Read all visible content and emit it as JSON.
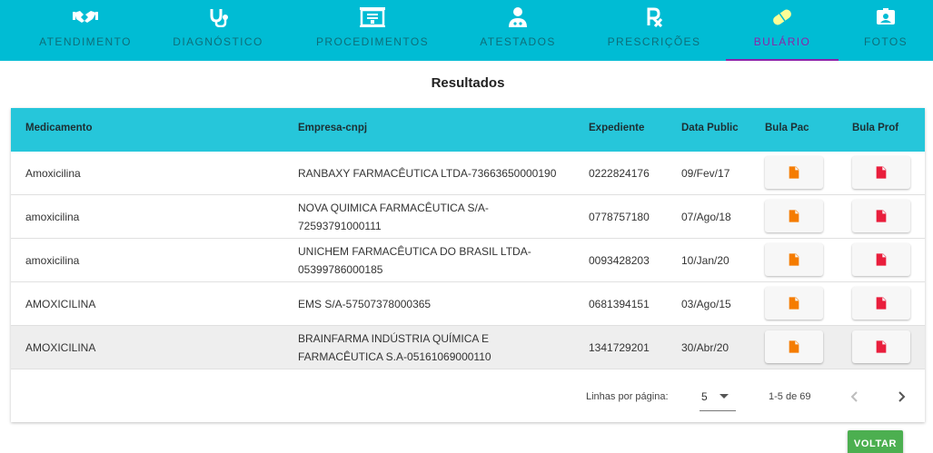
{
  "nav": {
    "tabs": [
      {
        "label": "ATENDIMENTO",
        "icon": "handshake-icon"
      },
      {
        "label": "DIAGNÓSTICO",
        "icon": "stethoscope-icon"
      },
      {
        "label": "PROCEDIMENTOS",
        "icon": "procedure-board-icon"
      },
      {
        "label": "ATESTADOS",
        "icon": "doctor-icon"
      },
      {
        "label": "PRESCRIÇÕES",
        "icon": "prescription-rx-icon"
      },
      {
        "label": "BULÁRIO",
        "icon": "pill-icon",
        "active": true
      },
      {
        "label": "FOTOS",
        "icon": "photo-badge-icon"
      }
    ],
    "colors": {
      "bar": "#00bcd4",
      "text": "#0e6e7a",
      "active": "#8e24aa",
      "icon": "#ffffff"
    }
  },
  "page": {
    "title": "Resultados"
  },
  "table": {
    "columns": [
      "Medicamento",
      "Empresa-cnpj",
      "Expediente",
      "Data Public",
      "Bula Pac",
      "Bula Prof"
    ],
    "rows": [
      {
        "medicamento": "Amoxicilina",
        "empresa": "RANBAXY FARMACÊUTICA LTDA-73663650000190",
        "expediente": "0222824176",
        "data": "09/Fev/17"
      },
      {
        "medicamento": "amoxicilina",
        "empresa": "NOVA QUIMICA FARMACÊUTICA S/A-72593791000111",
        "expediente": "0778757180",
        "data": "07/Ago/18"
      },
      {
        "medicamento": "amoxicilina",
        "empresa": "UNICHEM FARMACÊUTICA DO BRASIL LTDA-05399786000185",
        "expediente": "0093428203",
        "data": "10/Jan/20"
      },
      {
        "medicamento": "AMOXICILINA",
        "empresa": "EMS S/A-57507378000365",
        "expediente": "0681394151",
        "data": "03/Ago/15"
      },
      {
        "medicamento": "AMOXICILINA",
        "empresa": "BRAINFARMA INDÚSTRIA QUÍMICA E FARMACÊUTICA S.A-05161069000110",
        "expediente": "1341729201",
        "data": "30/Abr/20"
      }
    ],
    "header_color": "#26c6da",
    "bula_pac_color": "#f57c00",
    "bula_prof_color": "#e91e3c"
  },
  "pagination": {
    "rows_label": "Linhas por página:",
    "rows_value": "5",
    "range": "1-5 de 69"
  },
  "actions": {
    "voltar": "VOLTAR"
  }
}
